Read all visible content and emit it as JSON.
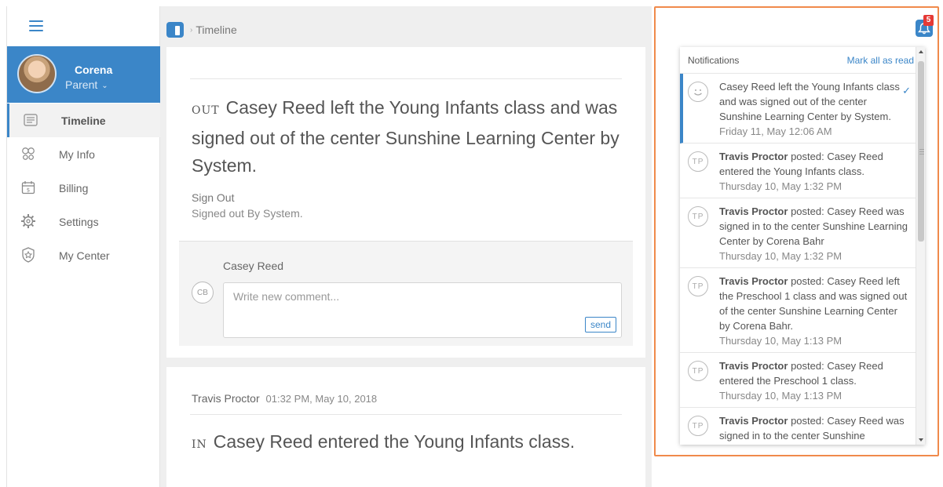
{
  "sidebar": {
    "user": {
      "name": "Corena",
      "role": "Parent"
    },
    "items": [
      {
        "label": "Timeline",
        "icon": "timeline-icon",
        "active": true
      },
      {
        "label": "My Info",
        "icon": "people-icon",
        "active": false
      },
      {
        "label": "Billing",
        "icon": "calendar-icon",
        "active": false
      },
      {
        "label": "Settings",
        "icon": "gear-icon",
        "active": false
      },
      {
        "label": "My Center",
        "icon": "badge-icon",
        "active": false
      }
    ]
  },
  "breadcrumb": {
    "current": "Timeline"
  },
  "entries": [
    {
      "badge": "OUT",
      "title": "Casey Reed left the Young Infants class and was signed out of the center Sunshine Learning Center by System.",
      "type": "Sign Out",
      "detail": "Signed out By System.",
      "comment": {
        "user": "Casey Reed",
        "avatar_initials": "CB",
        "placeholder": "Write new comment...",
        "send_label": "send"
      }
    },
    {
      "author": "Travis Proctor",
      "time": "01:32 PM, May 10, 2018",
      "badge": "IN",
      "title": "Casey Reed entered the Young Infants class."
    }
  ],
  "notifications": {
    "badge_count": "5",
    "title": "Notifications",
    "mark_all": "Mark all as read",
    "items": [
      {
        "avatar": "smiley-icon",
        "author": "",
        "text": "Casey Reed left the Young Infants class and was signed out of the center Sunshine Learning Center by System.",
        "time": "Friday 11, May 12:06 AM",
        "unread": true
      },
      {
        "avatar": "TP",
        "author": "Travis Proctor",
        "text": "posted: Casey Reed entered the Young Infants class.",
        "time": "Thursday 10, May 1:32 PM",
        "unread": false
      },
      {
        "avatar": "TP",
        "author": "Travis Proctor",
        "text": "posted: Casey Reed was signed in to the center Sunshine Learning Center by Corena Bahr",
        "time": "Thursday 10, May 1:32 PM",
        "unread": false
      },
      {
        "avatar": "TP",
        "author": "Travis Proctor",
        "text": "posted: Casey Reed left the Preschool 1 class and was signed out of the center Sunshine Learning Center by Corena Bahr.",
        "time": "Thursday 10, May 1:13 PM",
        "unread": false
      },
      {
        "avatar": "TP",
        "author": "Travis Proctor",
        "text": "posted: Casey Reed entered the Preschool 1 class.",
        "time": "Thursday 10, May 1:13 PM",
        "unread": false
      },
      {
        "avatar": "TP",
        "author": "Travis Proctor",
        "text": "posted: Casey Reed was signed in to the center Sunshine",
        "time": "",
        "unread": false
      }
    ]
  },
  "colors": {
    "accent": "#3b86c8",
    "highlight": "#f08a4b",
    "badge": "#e53935"
  }
}
